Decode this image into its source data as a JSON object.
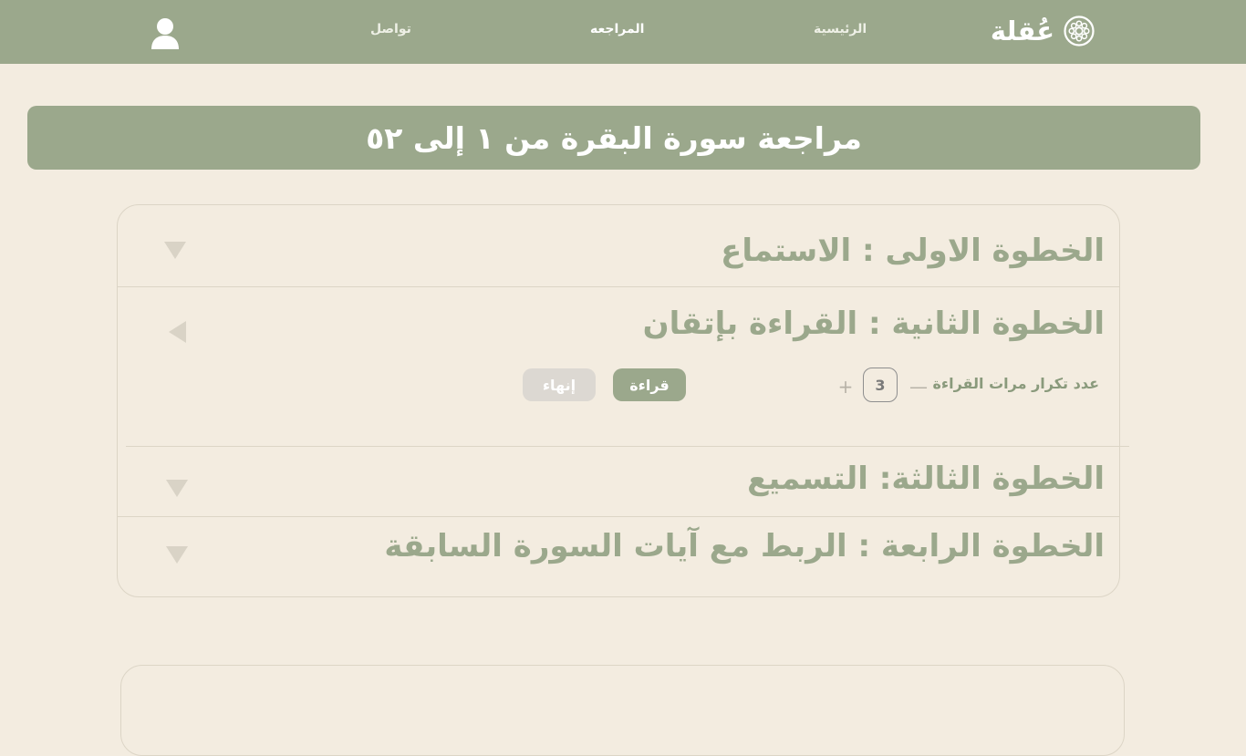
{
  "header": {
    "logo_text": "عُقلة",
    "nav": {
      "home": "الرئيسية",
      "review": "المراجعه",
      "contact": "تواصل"
    },
    "icons": {
      "logo": "flower-logo-icon",
      "user": "user-icon"
    }
  },
  "page": {
    "title": "مراجعة سورة البقرة من ١ إلى ٥٢"
  },
  "steps": [
    {
      "title": "الخطوة الاولى : الاستماع",
      "expanded": false
    },
    {
      "title": "الخطوة الثانية : القراءة بإتقان",
      "expanded": true
    },
    {
      "title": "الخطوة الثالثة: التسميع",
      "expanded": false
    },
    {
      "title": "الخطوة الرابعة : الربط مع آيات السورة السابقة",
      "expanded": false
    }
  ],
  "reading": {
    "repeat_label": "عدد تكرار مرات القراءة",
    "count": "3",
    "minus": "—",
    "plus": "+",
    "read_button": "قراءة",
    "finish_button": "إنهاء"
  },
  "colors": {
    "primary": "#9ba88c",
    "background": "#f3ece0",
    "muted": "#dcd8d2",
    "border": "#dcd5c6"
  }
}
